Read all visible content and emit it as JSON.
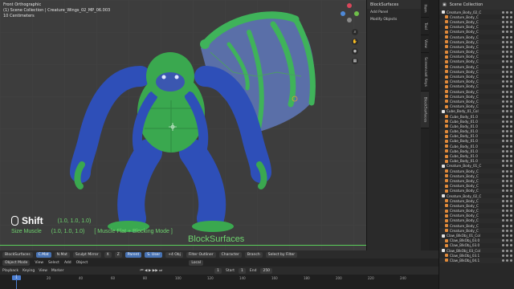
{
  "viewport": {
    "view_name": "Front Orthographic",
    "collection_info": "(1) Scene Collection | Creature_Wings_02_MP_06.003",
    "scale_info": "10 Centimeters"
  },
  "tool_panel": {
    "title": "BlockSurfaces",
    "items": [
      "Add Panel",
      "Modify Objects"
    ]
  },
  "vertical_tabs": [
    "Item",
    "Tool",
    "View",
    "Screencast Keys",
    "BlockSurfaces"
  ],
  "outliner": {
    "title": "Scene Collection",
    "rows": [
      "Creature_Body_02_C",
      "Creature_Body_C",
      "Creature_Body_C",
      "Creature_Body_C",
      "Creature_Body_C",
      "Creature_Body_C",
      "Creature_Body_C",
      "Creature_Body_C",
      "Creature_Body_C",
      "Creature_Body_C",
      "Creature_Body_C",
      "Creature_Body_C",
      "Creature_Body_C",
      "Creature_Body_C",
      "Creature_Body_C",
      "Creature_Body_C",
      "Creature_Body_C",
      "Creature_Body_C",
      "Creature_Body_C",
      "Creature_Body_C",
      "Cube_Body_01_Col",
      "Cube_Body_01.0",
      "Cube_Body_01.0",
      "Cube_Body_01.0",
      "Cube_Body_01.0",
      "Cube_Body_01.0",
      "Cube_Body_01.0",
      "Cube_Body_01.0",
      "Cube_Body_01.0",
      "Cube_Body_01.0",
      "Cube_Body_01.0",
      "Creature_Body_01_C",
      "Creature_Body_C",
      "Creature_Body_C",
      "Creature_Body_C",
      "Creature_Body_C",
      "Creature_Body_C",
      "Creature_Body_02_C",
      "Creature_Body_C",
      "Creature_Body_C",
      "Creature_Body_C",
      "Creature_Body_C",
      "Creature_Body_C",
      "Creature_Body_C",
      "Creature_Body_C",
      "Claw_BlkObj_01_Col",
      "Claw_BlkObj_03.0",
      "Claw_BlkObj_03.0",
      "Claw_BlkObj_03_Col",
      "Claw_BlkObj_03.1",
      "Claw_BlkObj_04.1"
    ]
  },
  "tool_header": {
    "items": [
      "BlockSurfaces",
      "C.Mat",
      "N.Mat",
      "Sculpt Mirror",
      "X",
      "Z",
      "Parent",
      "S. User",
      "+4 Obj",
      "Filter Outliner",
      "Character",
      "Branch",
      "Select by Filter"
    ]
  },
  "menu_bar": {
    "mode": "Object Mode",
    "items": [
      "View",
      "Select",
      "Add",
      "Object"
    ],
    "pivot": "Local"
  },
  "timeline_header": {
    "items": [
      "Playback",
      "Keying",
      "View",
      "Marker"
    ],
    "current_frame": "1",
    "start_label": "Start",
    "start": "1",
    "end_label": "End",
    "end": "250"
  },
  "timeline": {
    "ticks": [
      "0",
      "20",
      "40",
      "60",
      "80",
      "100",
      "120",
      "140",
      "160",
      "180",
      "200",
      "220",
      "240"
    ],
    "playhead": "1"
  },
  "keycast": {
    "key": "Shift",
    "line1_label": "",
    "line1_value": "(1.0, 1.0, 1.0)",
    "line2_label": "Size Muscle",
    "line2_value": "(1.0, 1.0, 1.0)",
    "line2_mode": "[ Muscle Flat + Blocking Mode ]",
    "addon": "BlockSurfaces"
  },
  "colors": {
    "body_blue": "#2e4fb8",
    "body_green": "#3aa84f",
    "wing_purple": "#5a6fa8",
    "wing_green": "#3fb35a",
    "accent": "#4772b3",
    "overlay_green": "#6fd46f"
  }
}
